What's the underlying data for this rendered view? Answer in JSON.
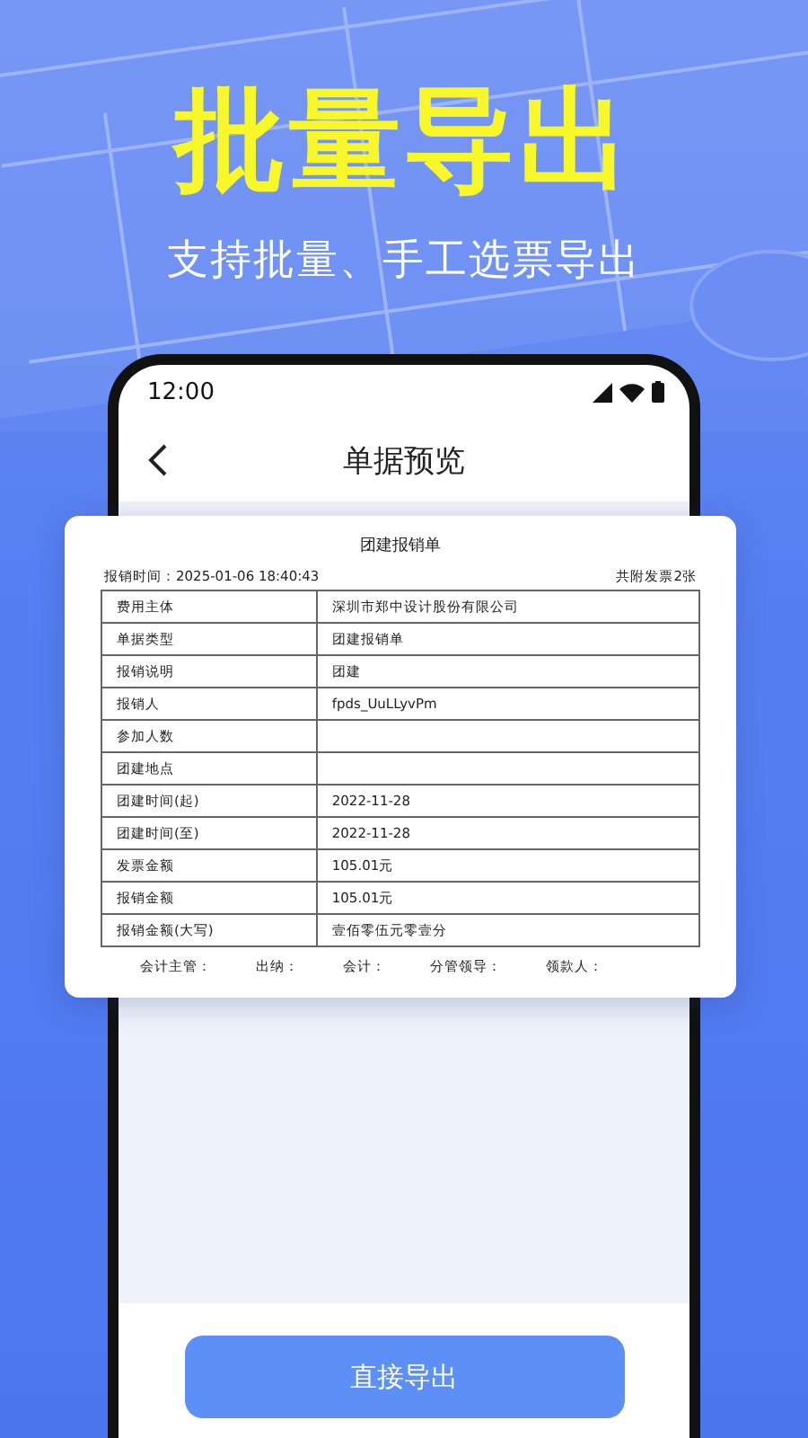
{
  "headline": "批量导出",
  "subtitle": "支持批量、手工选票导出",
  "phone": {
    "status_time": "12:00",
    "nav_title": "单据预览",
    "document": {
      "title": "团建报销单",
      "time_label": "报销时间：2025-01-06 18:40:43",
      "attachments": "共附发票2张",
      "rows": [
        {
          "label": "费用主体",
          "value": "深圳市郑中设计股份有限公司"
        },
        {
          "label": "单据类型",
          "value": "团建报销单"
        },
        {
          "label": "报销说明",
          "value": "团建"
        },
        {
          "label": "报销人",
          "value": "fpds_UuLLyvPm"
        },
        {
          "label": "参加人数"
        },
        {
          "label": "团建地点"
        },
        {
          "label": "团建时间(起)",
          "value": "2022-11-28"
        },
        {
          "label": "团建时间(至)",
          "value": "2022-11-28"
        },
        {
          "label": "发票金额",
          "value": "105.01元"
        },
        {
          "label": "报销金额",
          "value": "105.01元"
        },
        {
          "label": "报销金额(大写)",
          "value": "壹佰零伍元零壹分"
        }
      ],
      "signatures": [
        "会计主管：",
        "出纳：",
        "会计：",
        "分管领导：",
        "领款人："
      ]
    },
    "export_button": "直接导出"
  }
}
